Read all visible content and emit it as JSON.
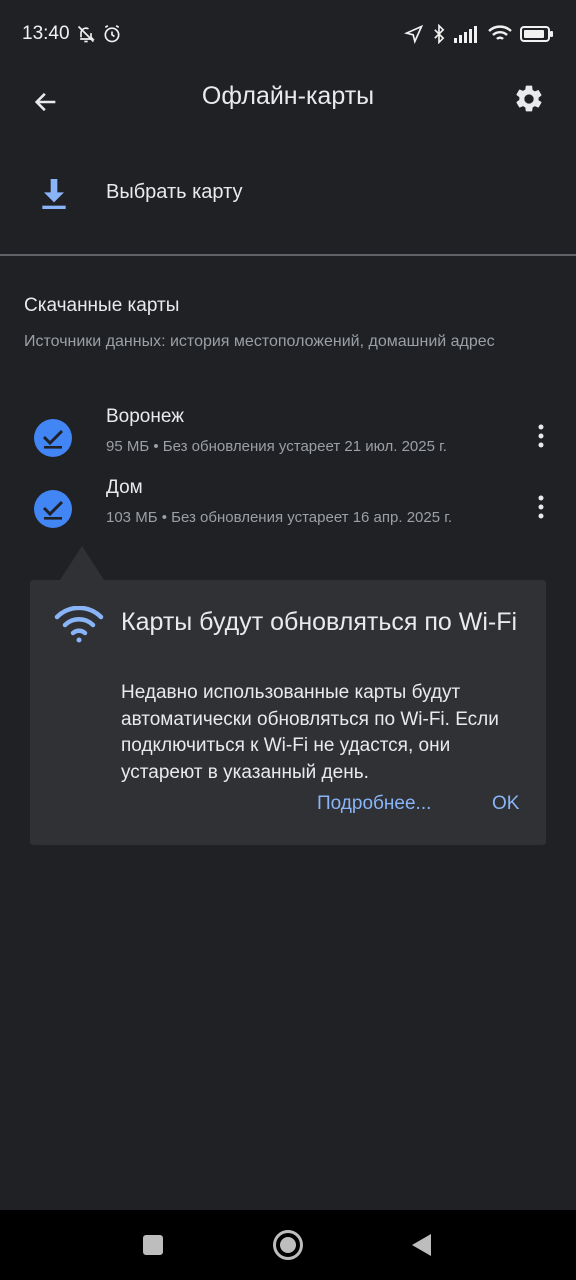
{
  "status_bar": {
    "time": "13:40",
    "icons": [
      "bell-off-icon",
      "alarm-icon",
      "location-icon",
      "bluetooth-icon",
      "signal-icon",
      "wifi-icon",
      "battery-icon"
    ]
  },
  "app_bar": {
    "title": "Офлайн-карты"
  },
  "select_map": {
    "label": "Выбрать карту"
  },
  "downloaded": {
    "title": "Скачанные карты",
    "subtitle": "Источники данных: история местоположений, домашний адрес",
    "items": [
      {
        "name": "Воронеж",
        "meta": "95 МБ • Без обновления устареет 21 июл. 2025 г."
      },
      {
        "name": "Дом",
        "meta": "103 МБ • Без обновления устареет 16 апр. 2025 г."
      }
    ]
  },
  "tooltip": {
    "title": "Карты будут обновляться по Wi-Fi",
    "body": "Недавно использованные карты будут автоматически обновляться по Wi-Fi. Если подключиться к Wi-Fi не удастся, они устареют в указанный день.",
    "more_label": "Подробнее...",
    "ok_label": "OK"
  },
  "colors": {
    "background": "#202124",
    "card": "#303134",
    "accent_blue": "#8ab4f8",
    "check_blue": "#4285f4",
    "text_primary": "#e8eaed",
    "text_secondary": "#9aa0a6"
  }
}
